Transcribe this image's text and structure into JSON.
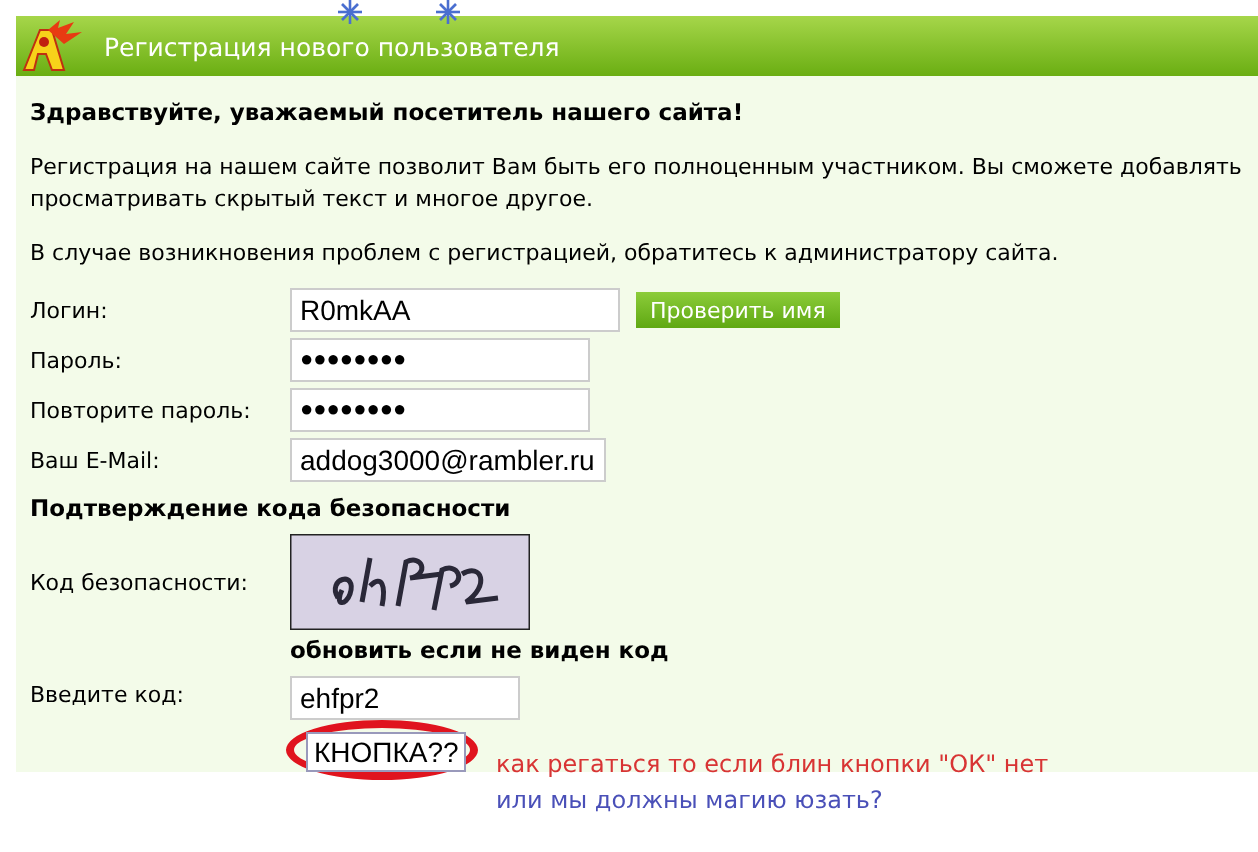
{
  "header": {
    "title": "Регистрация нового пользователя"
  },
  "greeting": "Здравствуйте, уважаемый посетитель нашего сайта!",
  "intro_lines": [
    "Регистрация на нашем сайте позволит Вам быть его полноценным участником. Вы сможете добавлять",
    "просматривать скрытый текст и многое другое."
  ],
  "help_text": "В случае возникновения проблем с регистрацией, обратитесь к администратору сайта.",
  "fields": [
    {
      "label": "Логин:",
      "value": "R0mkAA",
      "kind": "text"
    },
    {
      "label": "Пароль:",
      "value": "●●●●●●●●",
      "kind": "password"
    },
    {
      "label": "Повторите пароль:",
      "value": "●●●●●●●●",
      "kind": "password"
    },
    {
      "label": "Ваш E-Mail:",
      "value": "addog3000@rambler.ru",
      "kind": "text"
    }
  ],
  "check_button": "Проверить имя",
  "security": {
    "heading": "Подтверждение кода безопасности",
    "label": "Код безопасности:",
    "refresh_link": "обновить если не виден код",
    "code_label": "Введите код:",
    "code_value": "ehfpr2"
  },
  "submit_button": "КНОПКА??",
  "annotation": {
    "line_1": "как регаться то если блин кнопки \"ОК\" нет",
    "line_2": "или мы должны магию юзать?"
  }
}
